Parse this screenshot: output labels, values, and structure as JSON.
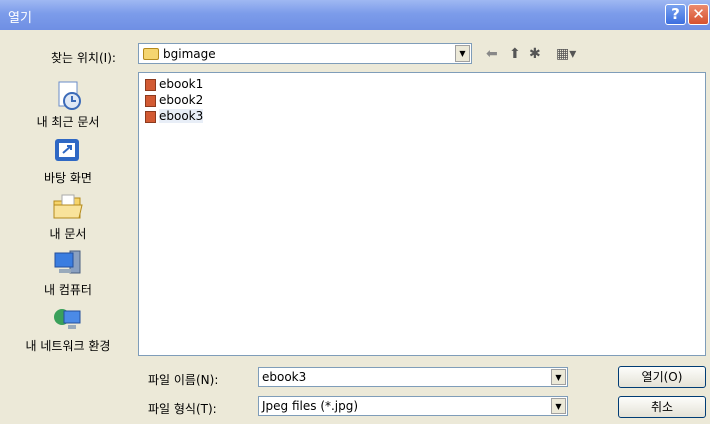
{
  "window": {
    "title": "열기"
  },
  "toolbar": {
    "lookin_label": "찾는 위치(I):",
    "lookin_value": "bgimage",
    "icons": [
      "back-arrow-icon",
      "up-one-level-icon",
      "new-folder-icon",
      "views-menu-icon"
    ]
  },
  "places": [
    {
      "label": "내 최근 문서",
      "icon": "recent-documents-icon"
    },
    {
      "label": "바탕 화면",
      "icon": "desktop-icon"
    },
    {
      "label": "내 문서",
      "icon": "my-documents-icon"
    },
    {
      "label": "내 컴퓨터",
      "icon": "my-computer-icon"
    },
    {
      "label": "내 네트워크 환경",
      "icon": "network-places-icon"
    }
  ],
  "files": [
    {
      "name": "ebook1",
      "icon": "jpeg-file-icon"
    },
    {
      "name": "ebook2",
      "icon": "jpeg-file-icon"
    },
    {
      "name": "ebook3",
      "icon": "jpeg-file-icon"
    }
  ],
  "form": {
    "filename_label": "파일 이름(N):",
    "filename_value": "ebook3",
    "filetype_label": "파일 형식(T):",
    "filetype_value": "Jpeg files (*.jpg)"
  },
  "buttons": {
    "open": "열기(O)",
    "cancel": "취소"
  },
  "colors": {
    "titlebar": "#7c9cea",
    "dialog_bg": "#ece9d8",
    "selection": "#e8eef7"
  }
}
